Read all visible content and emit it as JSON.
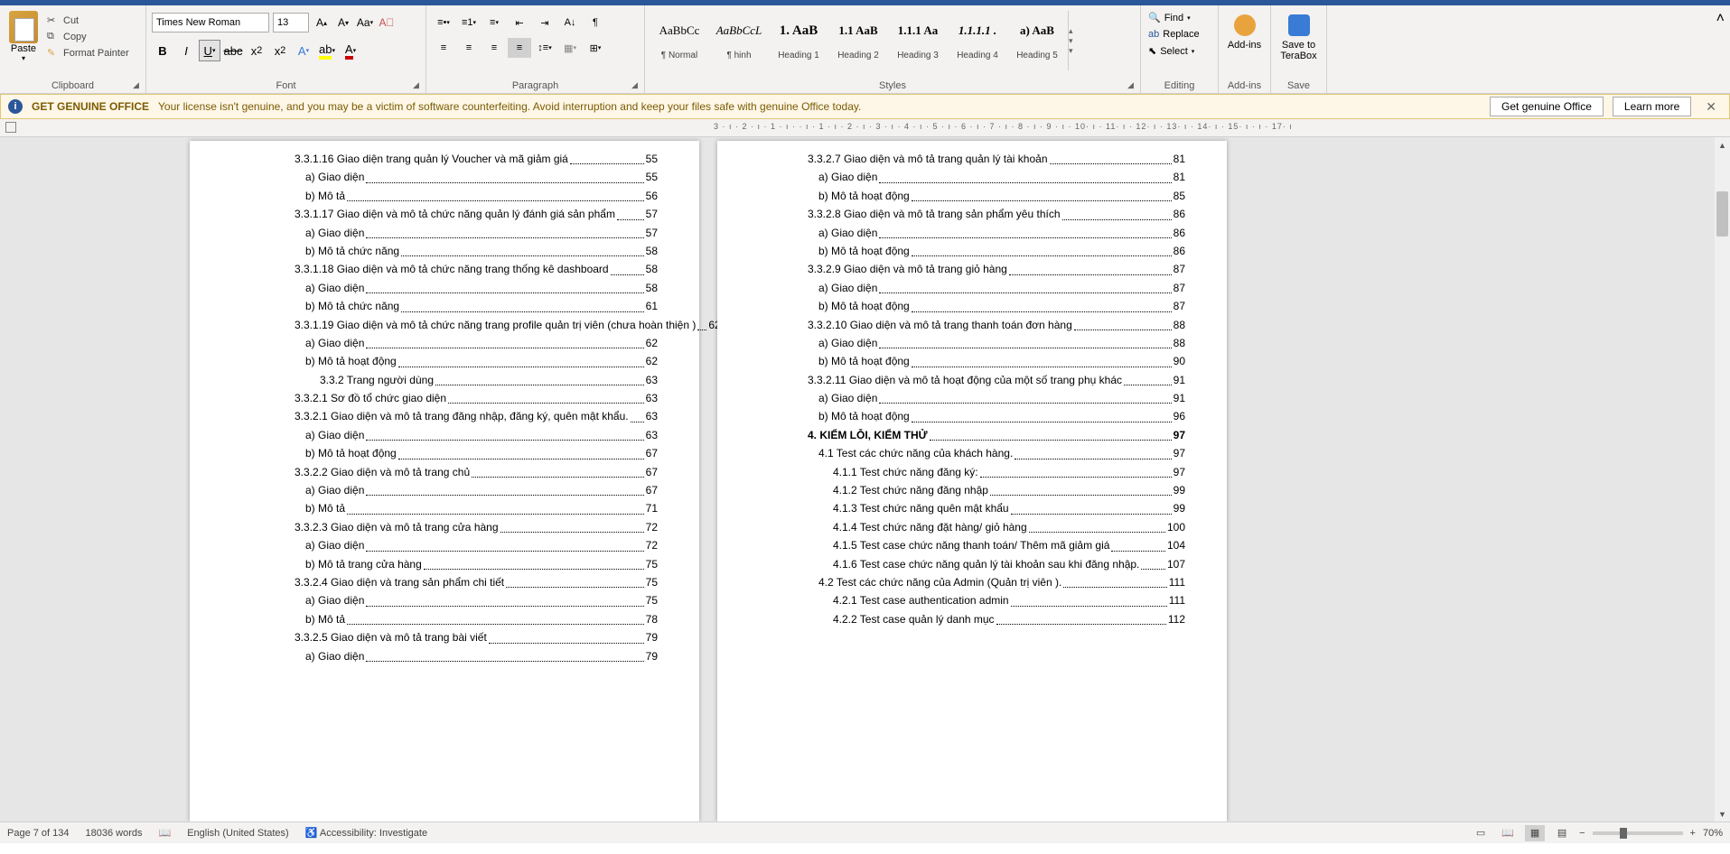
{
  "ribbon": {
    "clipboard": {
      "label": "Clipboard",
      "paste": "Paste",
      "cut": "Cut",
      "copy": "Copy",
      "format_painter": "Format Painter"
    },
    "font": {
      "label": "Font",
      "name_value": "Times New Roman",
      "size_value": "13"
    },
    "paragraph": {
      "label": "Paragraph"
    },
    "styles": {
      "label": "Styles",
      "items": [
        {
          "preview": "AaBbCc",
          "label": "¶ Normal"
        },
        {
          "preview": "AaBbCcL",
          "label": "¶ hinh"
        },
        {
          "preview": "1. AaB",
          "label": "Heading 1"
        },
        {
          "preview": "1.1 AaB",
          "label": "Heading 2"
        },
        {
          "preview": "1.1.1 Aa",
          "label": "Heading 3"
        },
        {
          "preview": "1.1.1.1 .",
          "label": "Heading 4"
        },
        {
          "preview": "a) AaB",
          "label": "Heading 5"
        }
      ]
    },
    "editing": {
      "label": "Editing",
      "find": "Find",
      "replace": "Replace",
      "select": "Select"
    },
    "addins": {
      "label": "Add-ins",
      "text": "Add-ins"
    },
    "save": {
      "label": "Save",
      "text1": "Save to",
      "text2": "TeraBox"
    }
  },
  "banner": {
    "title": "GET GENUINE OFFICE",
    "text": "Your license isn't genuine, and you may be a victim of software counterfeiting. Avoid interruption and keep your files safe with genuine Office today.",
    "btn1": "Get genuine Office",
    "btn2": "Learn more"
  },
  "ruler": "3 · ı · 2 · ı · 1 · ı ·    · ı · 1 · ı · 2 · ı · 3 · ı · 4 · ı · 5 · ı · 6 · ı · 7 · ı · 8 · ı · 9 · ı · 10· ı · 11· ı · 12· ı · 13· ı · 14· ı · 15· ı ·    ı · 17· ı",
  "toc_left": [
    {
      "text": "3.3.1.16 Giao diện trang quản lý Voucher và mã giảm giá",
      "page": "55",
      "cls": ""
    },
    {
      "text": "a) Giao diện",
      "page": "55",
      "cls": "indent1"
    },
    {
      "text": "b) Mô tả",
      "page": "56",
      "cls": "indent1"
    },
    {
      "text": "3.3.1.17 Giao diện và mô tả chức năng quản lý đánh giá sản phẩm",
      "page": "57",
      "cls": ""
    },
    {
      "text": "a) Giao diện",
      "page": "57",
      "cls": "indent1"
    },
    {
      "text": "b) Mô tả chức năng",
      "page": "58",
      "cls": "indent1"
    },
    {
      "text": "3.3.1.18 Giao diện và mô tả chức năng trang thống kê dashboard",
      "page": "58",
      "cls": ""
    },
    {
      "text": "a) Giao diện",
      "page": "58",
      "cls": "indent1"
    },
    {
      "text": "b) Mô tả chức năng",
      "page": "61",
      "cls": "indent1"
    },
    {
      "text": "3.3.1.19 Giao diện và mô tả chức năng trang profile quản trị viên (chưa hoàn thiện )",
      "page": "62",
      "cls": ""
    },
    {
      "text": "a) Giao diện",
      "page": "62",
      "cls": "indent1"
    },
    {
      "text": "b) Mô tả hoạt động",
      "page": "62",
      "cls": "indent1"
    },
    {
      "text": "3.3.2 Trang người dùng",
      "page": "63",
      "cls": "indent2"
    },
    {
      "text": "3.3.2.1 Sơ đồ tổ chức giao diện",
      "page": "63",
      "cls": ""
    },
    {
      "text": "3.3.2.1 Giao diện và mô tả trang đăng nhập, đăng ký, quên mật khẩu.",
      "page": "63",
      "cls": ""
    },
    {
      "text": "a) Giao diện",
      "page": "63",
      "cls": "indent1"
    },
    {
      "text": "b) Mô tả hoạt động",
      "page": "67",
      "cls": "indent1"
    },
    {
      "text": "3.3.2.2 Giao diện và mô tả trang chủ",
      "page": "67",
      "cls": ""
    },
    {
      "text": "a) Giao diện",
      "page": "67",
      "cls": "indent1"
    },
    {
      "text": "b) Mô tả",
      "page": "71",
      "cls": "indent1"
    },
    {
      "text": "3.3.2.3 Giao diện và mô tả trang cửa hàng",
      "page": "72",
      "cls": ""
    },
    {
      "text": "a) Giao diện",
      "page": "72",
      "cls": "indent1"
    },
    {
      "text": "b) Mô tả trang cửa hàng",
      "page": "75",
      "cls": "indent1"
    },
    {
      "text": "3.3.2.4 Giao diện và trang sản phẩm chi tiết",
      "page": "75",
      "cls": ""
    },
    {
      "text": "a) Giao diện",
      "page": "75",
      "cls": "indent1"
    },
    {
      "text": "b) Mô tả",
      "page": "78",
      "cls": "indent1"
    },
    {
      "text": "3.3.2.5 Giao diện và mô tả trang bài viết",
      "page": "79",
      "cls": ""
    },
    {
      "text": "a) Giao diện",
      "page": "79",
      "cls": "indent1"
    }
  ],
  "toc_right": [
    {
      "text": "3.3.2.7 Giao diện và mô tả trang quản lý tài khoản",
      "page": "81",
      "cls": ""
    },
    {
      "text": "a) Giao diện",
      "page": "81",
      "cls": "indent1"
    },
    {
      "text": "b) Mô tả hoạt động",
      "page": "85",
      "cls": "indent1"
    },
    {
      "text": "3.3.2.8 Giao diện và mô tả trang sản phẩm yêu thích",
      "page": "86",
      "cls": ""
    },
    {
      "text": "a) Giao diện",
      "page": "86",
      "cls": "indent1"
    },
    {
      "text": "b) Mô tả hoạt động",
      "page": "86",
      "cls": "indent1"
    },
    {
      "text": "3.3.2.9 Giao diện và mô tả trang giỏ hàng",
      "page": "87",
      "cls": ""
    },
    {
      "text": "a) Giao diện",
      "page": "87",
      "cls": "indent1"
    },
    {
      "text": "b) Mô tả hoạt động",
      "page": "87",
      "cls": "indent1"
    },
    {
      "text": "3.3.2.10 Giao diện và mô tả trang thanh toán đơn hàng",
      "page": "88",
      "cls": ""
    },
    {
      "text": "a) Giao diện",
      "page": "88",
      "cls": "indent1"
    },
    {
      "text": "b) Mô tả hoạt động",
      "page": "90",
      "cls": "indent1"
    },
    {
      "text": "3.3.2.11 Giao diện và mô tả hoạt động của một số trang phụ khác",
      "page": "91",
      "cls": ""
    },
    {
      "text": "a) Giao diện",
      "page": "91",
      "cls": "indent1"
    },
    {
      "text": "b) Mô tả hoạt động",
      "page": "96",
      "cls": "indent1"
    },
    {
      "text": "4. KIỂM LỖI, KIỂM THỬ",
      "page": "97",
      "cls": "bold"
    },
    {
      "text": "4.1 Test các chức năng của khách hàng.",
      "page": "97",
      "cls": "indent1"
    },
    {
      "text": "4.1.1 Test chức năng đăng ký:",
      "page": "97",
      "cls": "indent2"
    },
    {
      "text": "4.1.2 Test chức năng đăng nhập",
      "page": "99",
      "cls": "indent2"
    },
    {
      "text": "4.1.3 Test chức năng quên mật khẩu",
      "page": "99",
      "cls": "indent2"
    },
    {
      "text": "4.1.4 Test chức năng đặt hàng/ giỏ hàng",
      "page": "100",
      "cls": "indent2"
    },
    {
      "text": "4.1.5 Test case chức năng thanh toán/ Thêm mã giảm giá",
      "page": "104",
      "cls": "indent2"
    },
    {
      "text": "4.1.6 Test case chức năng quản lý tài khoản sau khi đăng nhập.",
      "page": "107",
      "cls": "indent2"
    },
    {
      "text": "4.2 Test các chức năng của Admin (Quản trị viên ).",
      "page": "111",
      "cls": "indent1"
    },
    {
      "text": "4.2.1 Test case authentication admin",
      "page": "111",
      "cls": "indent2"
    },
    {
      "text": "4.2.2 Test case quản lý danh mục",
      "page": "112",
      "cls": "indent2"
    }
  ],
  "status": {
    "page": "Page 7 of 134",
    "words": "18036 words",
    "lang": "English (United States)",
    "accessibility": "Accessibility: Investigate",
    "zoom": "70%"
  }
}
